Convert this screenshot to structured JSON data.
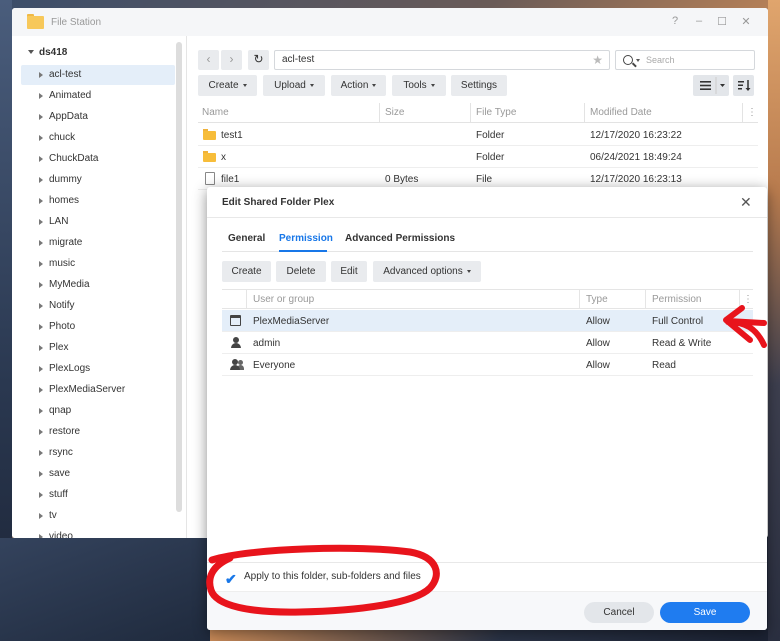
{
  "window": {
    "title": "File Station",
    "help": "?",
    "minimize": "–",
    "maximize": "☐",
    "close": "✕"
  },
  "sidebar": {
    "root": "ds418",
    "items": [
      "acl-test",
      "Animated",
      "AppData",
      "chuck",
      "ChuckData",
      "dummy",
      "homes",
      "LAN",
      "migrate",
      "music",
      "MyMedia",
      "Notify",
      "Photo",
      "Plex",
      "PlexLogs",
      "PlexMediaServer",
      "qnap",
      "restore",
      "rsync",
      "save",
      "stuff",
      "tv",
      "video"
    ]
  },
  "nav": {
    "back": "‹",
    "forward": "›",
    "refresh": "↻"
  },
  "path": {
    "value": "acl-test",
    "star": "★"
  },
  "search": {
    "placeholder": "Search"
  },
  "toolbar": {
    "create": "Create",
    "upload": "Upload",
    "action": "Action",
    "tools": "Tools",
    "settings": "Settings"
  },
  "files": {
    "columns": [
      "Name",
      "Size",
      "File Type",
      "Modified Date"
    ],
    "more": "⋮",
    "rows": [
      {
        "name": "test1",
        "size": "",
        "type": "Folder",
        "date": "12/17/2020 16:23:22"
      },
      {
        "name": "x",
        "size": "",
        "type": "Folder",
        "date": "06/24/2021 18:49:24"
      },
      {
        "name": "file1",
        "size": "0 Bytes",
        "type": "File",
        "date": "12/17/2020 16:23:13"
      }
    ]
  },
  "dialog": {
    "title": "Edit Shared Folder Plex",
    "close": "✕",
    "tabs": [
      "General",
      "Permission",
      "Advanced Permissions"
    ],
    "active_tab": "Permission",
    "buttons": {
      "create": "Create",
      "delete": "Delete",
      "edit": "Edit",
      "advanced": "Advanced options"
    },
    "columns": [
      "User or group",
      "Type",
      "Permission"
    ],
    "more": "⋮",
    "rows": [
      {
        "user": "PlexMediaServer",
        "type": "Allow",
        "perm": "Full Control"
      },
      {
        "user": "admin",
        "type": "Allow",
        "perm": "Read & Write"
      },
      {
        "user": "Everyone",
        "type": "Allow",
        "perm": "Read"
      }
    ],
    "apply_check": "✔",
    "apply_label": "Apply to this folder, sub-folders and files",
    "cancel": "Cancel",
    "save": "Save"
  },
  "colors": {
    "accent": "#1877e8",
    "save": "#1f7cf0",
    "annotation": "#e8141c",
    "folder": "#f7bd3a"
  },
  "icons": [
    "folder-icon",
    "file-icon",
    "search-icon",
    "list-view-icon",
    "sort-icon",
    "window-icon",
    "user-icon",
    "users-icon",
    "checkmark-icon"
  ]
}
